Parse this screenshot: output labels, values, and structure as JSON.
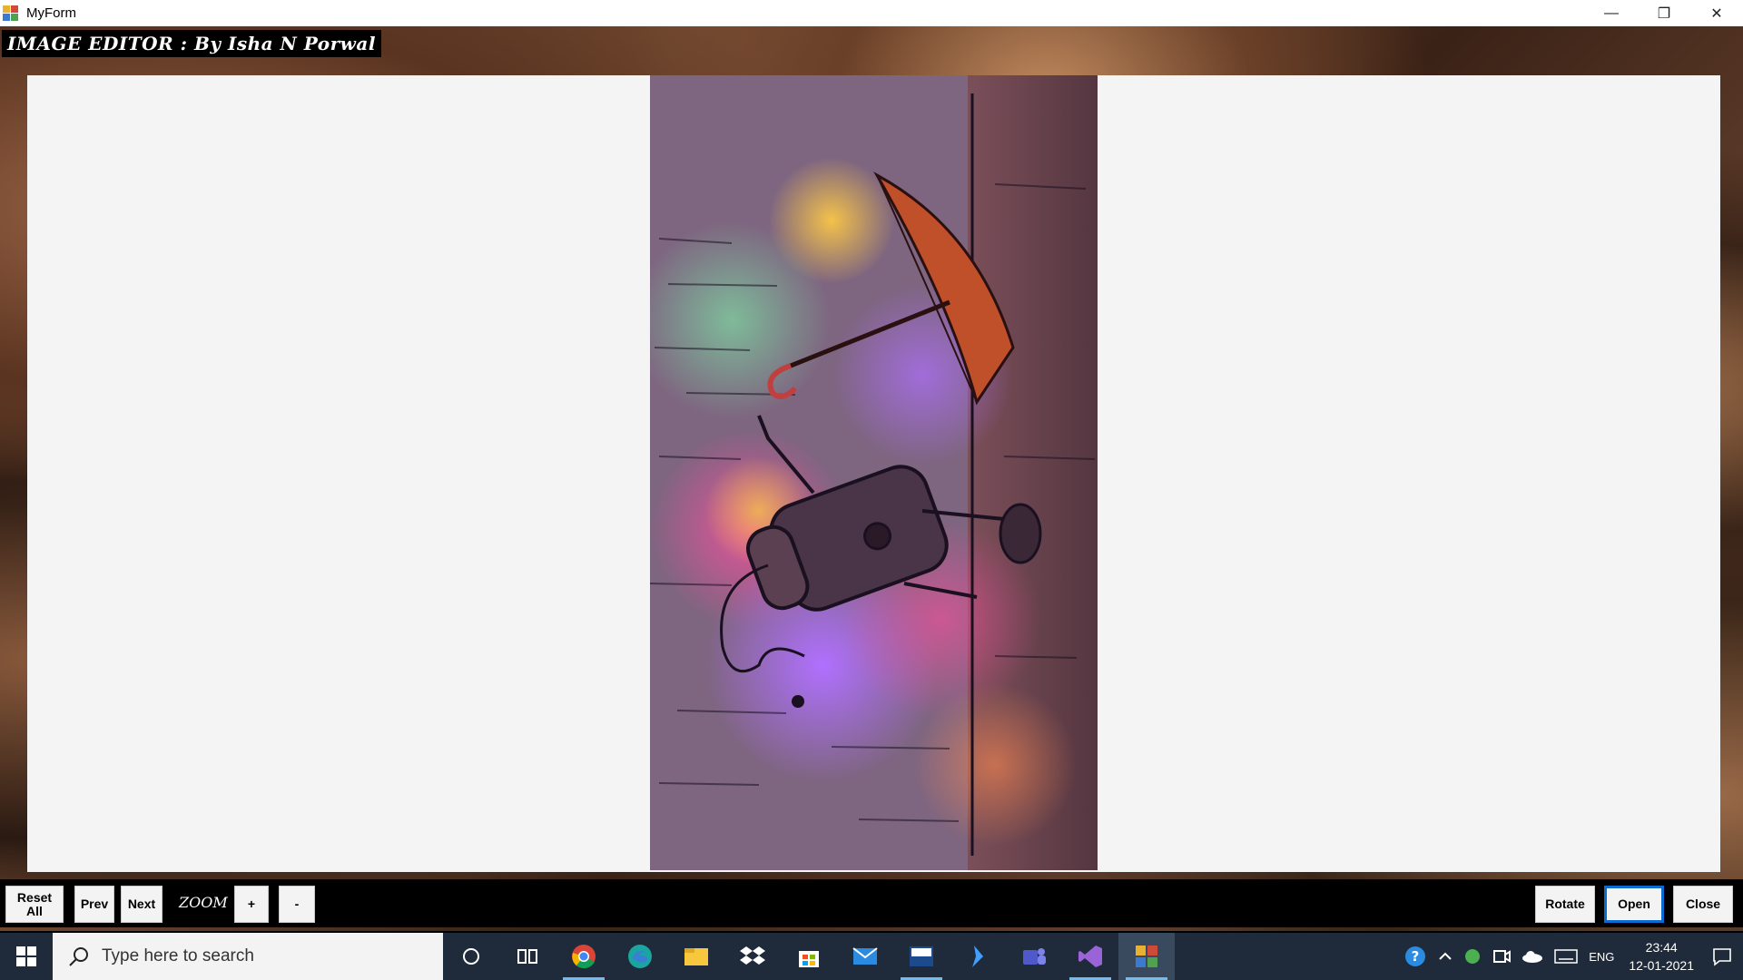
{
  "window": {
    "title": "MyForm",
    "controls": {
      "minimize": "—",
      "restore": "❐",
      "close": "✕"
    }
  },
  "header": {
    "label": "IMAGE EDITOR : By Isha N Porwal"
  },
  "image": {
    "icon": "robot-umbrella-illustration",
    "colors": {
      "bg": "#7a5f7c",
      "umbrella": "#c0502a",
      "robot": "#4a3448"
    }
  },
  "toolbar": {
    "reset_all": "Reset\nAll",
    "prev": "Prev",
    "next": "Next",
    "zoom_label": "ZOOM",
    "zoom_in": "+",
    "zoom_out": "-",
    "rotate": "Rotate",
    "open": "Open",
    "close": "Close"
  },
  "taskbar": {
    "search_placeholder": "Type here to search",
    "apps": [
      "cortana-icon",
      "task-view-icon",
      "chrome-icon",
      "edge-icon",
      "file-explorer-icon",
      "dropbox-icon",
      "store-icon",
      "mail-icon",
      "devcpp-icon",
      "powershell-ise-icon",
      "teams-icon",
      "visual-studio-icon",
      "myform-app-icon"
    ],
    "tray": {
      "language": "ENG",
      "time": "23:44",
      "date": "12-01-2021"
    }
  }
}
